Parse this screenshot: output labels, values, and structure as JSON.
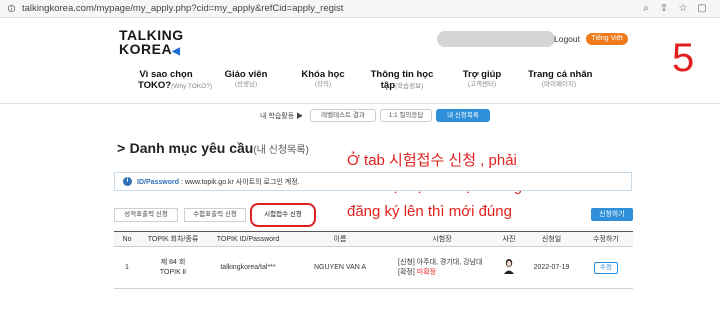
{
  "browser": {
    "url": "talkingkorea.com/mypage/my_apply.php?cid=my_apply&refCid=apply_regist"
  },
  "header": {
    "logo_line1": "TALKING",
    "logo_line2": "KOREA",
    "logout": "Logout",
    "lang_button": "Tiếng Việt",
    "big_number": "5"
  },
  "nav": [
    {
      "title": "Vì sao chọn",
      "title2": "TOKO?",
      "sub": "(Why TOKO?)"
    },
    {
      "title": "Giáo viên",
      "sub": "(선생님)"
    },
    {
      "title": "Khóa học",
      "sub": "(강의)"
    },
    {
      "title": "Thông tin học",
      "title2": "tập",
      "sub": "(학습정보)"
    },
    {
      "title": "Trợ giúp",
      "sub": "(고객센터)"
    },
    {
      "title": "Trang cá nhân",
      "sub": "(마이페이지)"
    }
  ],
  "subnav": {
    "label": "내 학습활동",
    "arrow": "▶",
    "items": [
      "레벨테스트 결과",
      "1:1 질의응답",
      "내 신청목록"
    ],
    "active_index": 2
  },
  "page_title": {
    "chevron": ">",
    "main": "Danh mục yêu cầu",
    "sub": "(내 신청목록)"
  },
  "annotation": {
    "line1": "Ở tab 시험접수 신청 , phải",
    "line2": "xác nhận lại đã hiện thông tin",
    "line3": "đăng ký lên thì mới đúng",
    "color": "#e0201e"
  },
  "info": {
    "icon": "i",
    "label": "ID/Password",
    "text": " : www.topik.go.kr 사이트의 로그인 계정."
  },
  "tabs": [
    "성적표출력 신청",
    "수험표출력 신청",
    "시험접수 신청"
  ],
  "active_tab": 2,
  "apply_button": "신청하기",
  "table": {
    "headers": [
      "No",
      "TOPIK 회차/종류",
      "TOPIK ID/Password",
      "이름",
      "시험장",
      "사진",
      "신청일",
      "수정하기"
    ],
    "row": {
      "no": "1",
      "round_line1": "제 84 회",
      "round_line2": "TOPIK Ⅱ",
      "id_password": "talkingkorea/tal***",
      "name": "NGUYEN VAN A",
      "exam_line1": "[신청] 아주대, 경기대, 강남대",
      "exam_confirm_label": "[확정]",
      "exam_confirm_value": "미확정",
      "date": "2022-07-19",
      "edit_button": "수정"
    }
  },
  "colors": {
    "accent_blue": "#2f8fd8",
    "lang_orange": "#f07a1a",
    "annotation_red": "#e0201e"
  }
}
